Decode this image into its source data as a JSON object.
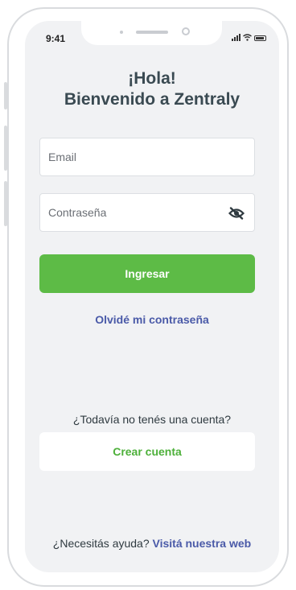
{
  "status_bar": {
    "time": "9:41",
    "icons": [
      "signal-icon",
      "wifi-icon",
      "battery-icon"
    ]
  },
  "greeting": {
    "line1": "¡Hola!",
    "line2": "Bienvenido a Zentraly"
  },
  "form": {
    "email_placeholder": "Email",
    "password_placeholder": "Contraseña",
    "password_toggle_icon": "eye-slash-icon"
  },
  "actions": {
    "login_label": "Ingresar",
    "forgot_label": "Olvidé mi contraseña"
  },
  "signup": {
    "prompt": "¿Todavía no tenés una cuenta?",
    "button_label": "Crear cuenta"
  },
  "help": {
    "prompt": "¿Necesitás ayuda?",
    "link_label": "Visitá nuestra web"
  },
  "colors": {
    "primary_green": "#5dbb46",
    "link_blue": "#4a5aa8",
    "heading": "#3a4a52",
    "screen_bg": "#f1f2f4"
  }
}
